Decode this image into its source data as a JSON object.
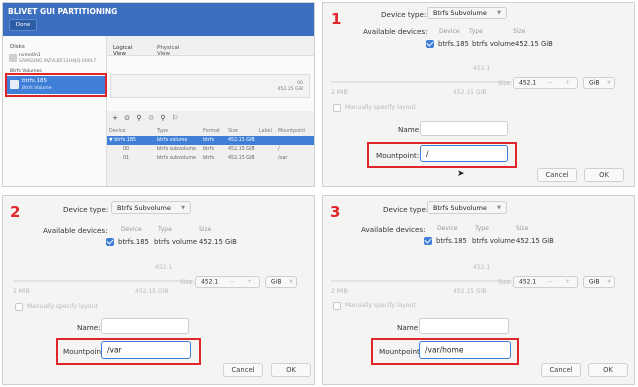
{
  "main_window": {
    "title": "BLIVET GUI PARTITIONING",
    "done_label": "Done",
    "disks_label": "Disks",
    "disk_name": "nvme0n1",
    "disk_desc": "SAMSUNG MZVLB512HAJQ-000L7",
    "btrfs_volumes_label": "Btrfs Volumes",
    "selected_volume_name": "btrfs.185",
    "selected_volume_type": "Btrfs Volume",
    "tabs": [
      "Logical View",
      "Physical View"
    ],
    "bar_label_line1": "00",
    "bar_label_line2": "452.15 GiB",
    "table_headers": [
      "Device",
      "Type",
      "Format",
      "Size",
      "Label",
      "Mountpoint"
    ],
    "rows": [
      {
        "device": "▼ btrfs.185",
        "type": "btrfs volume",
        "format": "btrfs",
        "size": "452.15 GiB",
        "label": "",
        "mount": ""
      },
      {
        "device": "00",
        "type": "btrfs subvolume",
        "format": "btrfs",
        "size": "452.15 GiB",
        "label": "",
        "mount": "/"
      },
      {
        "device": "01",
        "type": "btrfs subvolume",
        "format": "btrfs",
        "size": "452.15 GiB",
        "label": "",
        "mount": "/var"
      }
    ]
  },
  "dialog": {
    "device_type_label": "Device type:",
    "device_type_value": "Btrfs Subvolume",
    "available_devices_label": "Available devices:",
    "col_device": "Device",
    "col_type": "Type",
    "col_size": "Size",
    "dev_name": "btrfs.185",
    "dev_type": "btrfs volume",
    "dev_size": "452.15 GiB",
    "slider_max_top": "452.1",
    "slider_min": "2 MiB",
    "slider_max": "452.15 GiB",
    "size_label": "Size:",
    "size_value": "452.1",
    "minus": "—",
    "plus": "+",
    "unit": "GiB",
    "manual_layout": "Manually specify layout",
    "name_label": "Name:",
    "mountpoint_label": "Mountpoint:",
    "cancel": "Cancel",
    "ok": "OK"
  },
  "steps": [
    {
      "number": "1",
      "mountpoint": "/"
    },
    {
      "number": "2",
      "mountpoint": "/var"
    },
    {
      "number": "3",
      "mountpoint": "/var/home"
    }
  ],
  "colors": {
    "accent": "#3f7fd8",
    "highlight": "#e0262b",
    "titlebar": "#3c6fbf"
  }
}
